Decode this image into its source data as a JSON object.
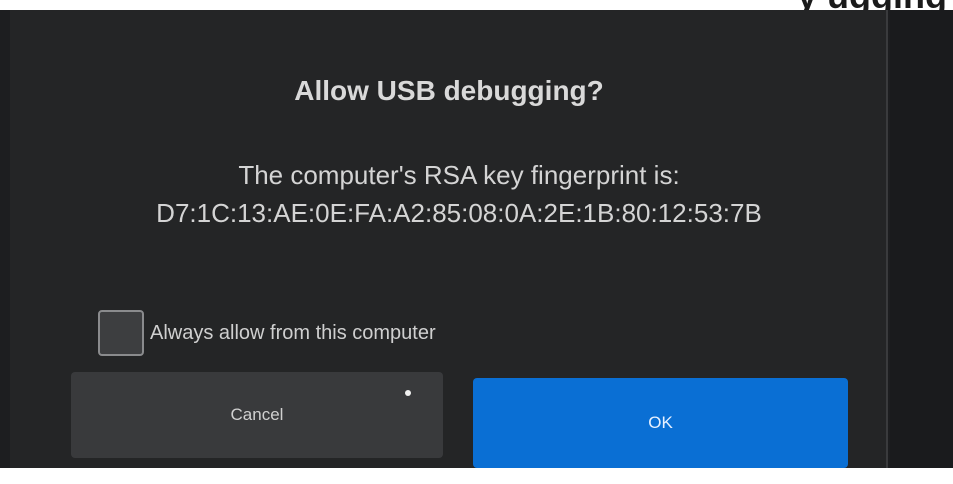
{
  "header_fragment": "y                  ugging",
  "dialog": {
    "title": "Allow USB debugging?",
    "message_line1": "The computer's RSA key fingerprint is:",
    "fingerprint": "D7:1C:13:AE:0E:FA:A2:85:08:0A:2E:1B:80:12:53:7B",
    "checkbox_label": "Always allow from this computer",
    "checkbox_checked": false,
    "cancel_label": "Cancel",
    "ok_label": "OK"
  },
  "colors": {
    "dialog_bg": "#242526",
    "ok_button": "#0a6fd4",
    "cancel_button": "#393a3c",
    "text": "#d9d9d9"
  }
}
